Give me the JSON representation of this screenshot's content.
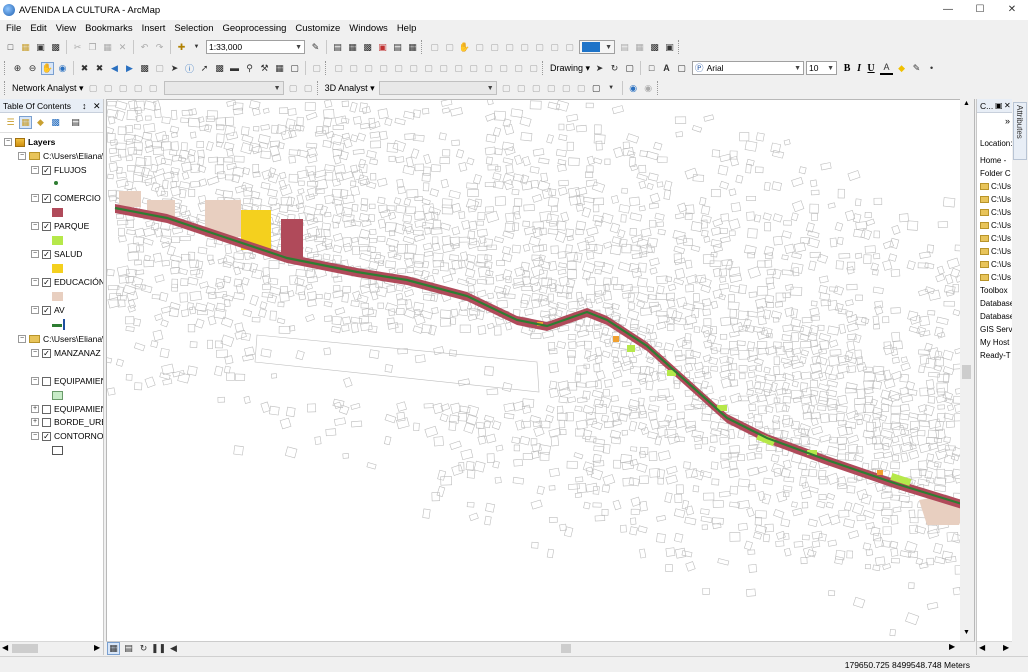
{
  "window": {
    "title": "AVENIDA LA CULTURA - ArcMap",
    "minimize": "—",
    "maximize": "☐",
    "close": "✕"
  },
  "menu": [
    "File",
    "Edit",
    "View",
    "Bookmarks",
    "Insert",
    "Selection",
    "Geoprocessing",
    "Customize",
    "Windows",
    "Help"
  ],
  "toolbar": {
    "scale": "1:33,000",
    "drawing_label": "Drawing",
    "font_name": "Arial",
    "font_size": "10",
    "bold": "B",
    "italic": "I",
    "underline": "U",
    "network_analyst": "Network Analyst",
    "analyst_3d": "3D Analyst",
    "text_tool": "A",
    "accent_color": "#1e73c8"
  },
  "toc": {
    "title": "Table Of Contents",
    "pin": "↕",
    "close": "✕",
    "root": "Layers",
    "groups": [
      {
        "path": "C:\\Users\\Eliana\\l",
        "layers": [
          {
            "name": "FLUJOS",
            "checked": true,
            "swatch": "#2e7d32",
            "symbol": "dot"
          },
          {
            "name": "COMERCIO",
            "checked": true,
            "swatch": "#b04a5a",
            "symbol": "fill"
          },
          {
            "name": "PARQUE",
            "checked": true,
            "swatch": "#b6e84a",
            "symbol": "fill"
          },
          {
            "name": "SALUD",
            "checked": true,
            "swatch": "#f4d01e",
            "symbol": "fill"
          },
          {
            "name": "EDUCACIÓN",
            "checked": true,
            "swatch": "#e8cfc0",
            "symbol": "fill"
          },
          {
            "name": "AV",
            "checked": true,
            "swatch": "#2e7d32",
            "symbol": "line",
            "line_accent": "#1e50a0"
          }
        ]
      },
      {
        "path": "C:\\Users\\Eliana\\l",
        "layers": [
          {
            "name": "MANZANAZ",
            "checked": true,
            "swatch": "#ffffff",
            "symbol": "none"
          },
          {
            "name": "EQUIPAMIEN",
            "checked": false,
            "swatch": "#c8ecc8",
            "symbol": "fill"
          },
          {
            "name": "EQUIPAMIEN",
            "checked": false,
            "collapsed": true,
            "symbol": "none"
          },
          {
            "name": "BORDE_URBA",
            "checked": false,
            "collapsed": true,
            "symbol": "none"
          },
          {
            "name": "CONTORNO",
            "checked": true,
            "swatch": "#ffffff",
            "symbol": "fill"
          }
        ]
      }
    ]
  },
  "catalog": {
    "title": "C...",
    "location_label": "Location:",
    "items": [
      "Home -",
      "Folder C",
      "C:\\Us",
      "C:\\Us",
      "C:\\Us",
      "C:\\Us",
      "C:\\Us",
      "C:\\Us",
      "C:\\Us",
      "C:\\Us",
      "Toolbox",
      "Database",
      "Database",
      "GIS Serve",
      "My Host",
      "Ready-T"
    ],
    "side_tab": "Attributes"
  },
  "map": {
    "colors": {
      "blocks": "#b9b9b9",
      "comercio": "#b04a5a",
      "parque": "#b6e84a",
      "salud": "#f4d01e",
      "educacion": "#e8cfc0",
      "av": "#2e7d32",
      "orange": "#f0a030"
    }
  },
  "status": {
    "coordinates": "179650.725  8499548.748 Meters"
  }
}
